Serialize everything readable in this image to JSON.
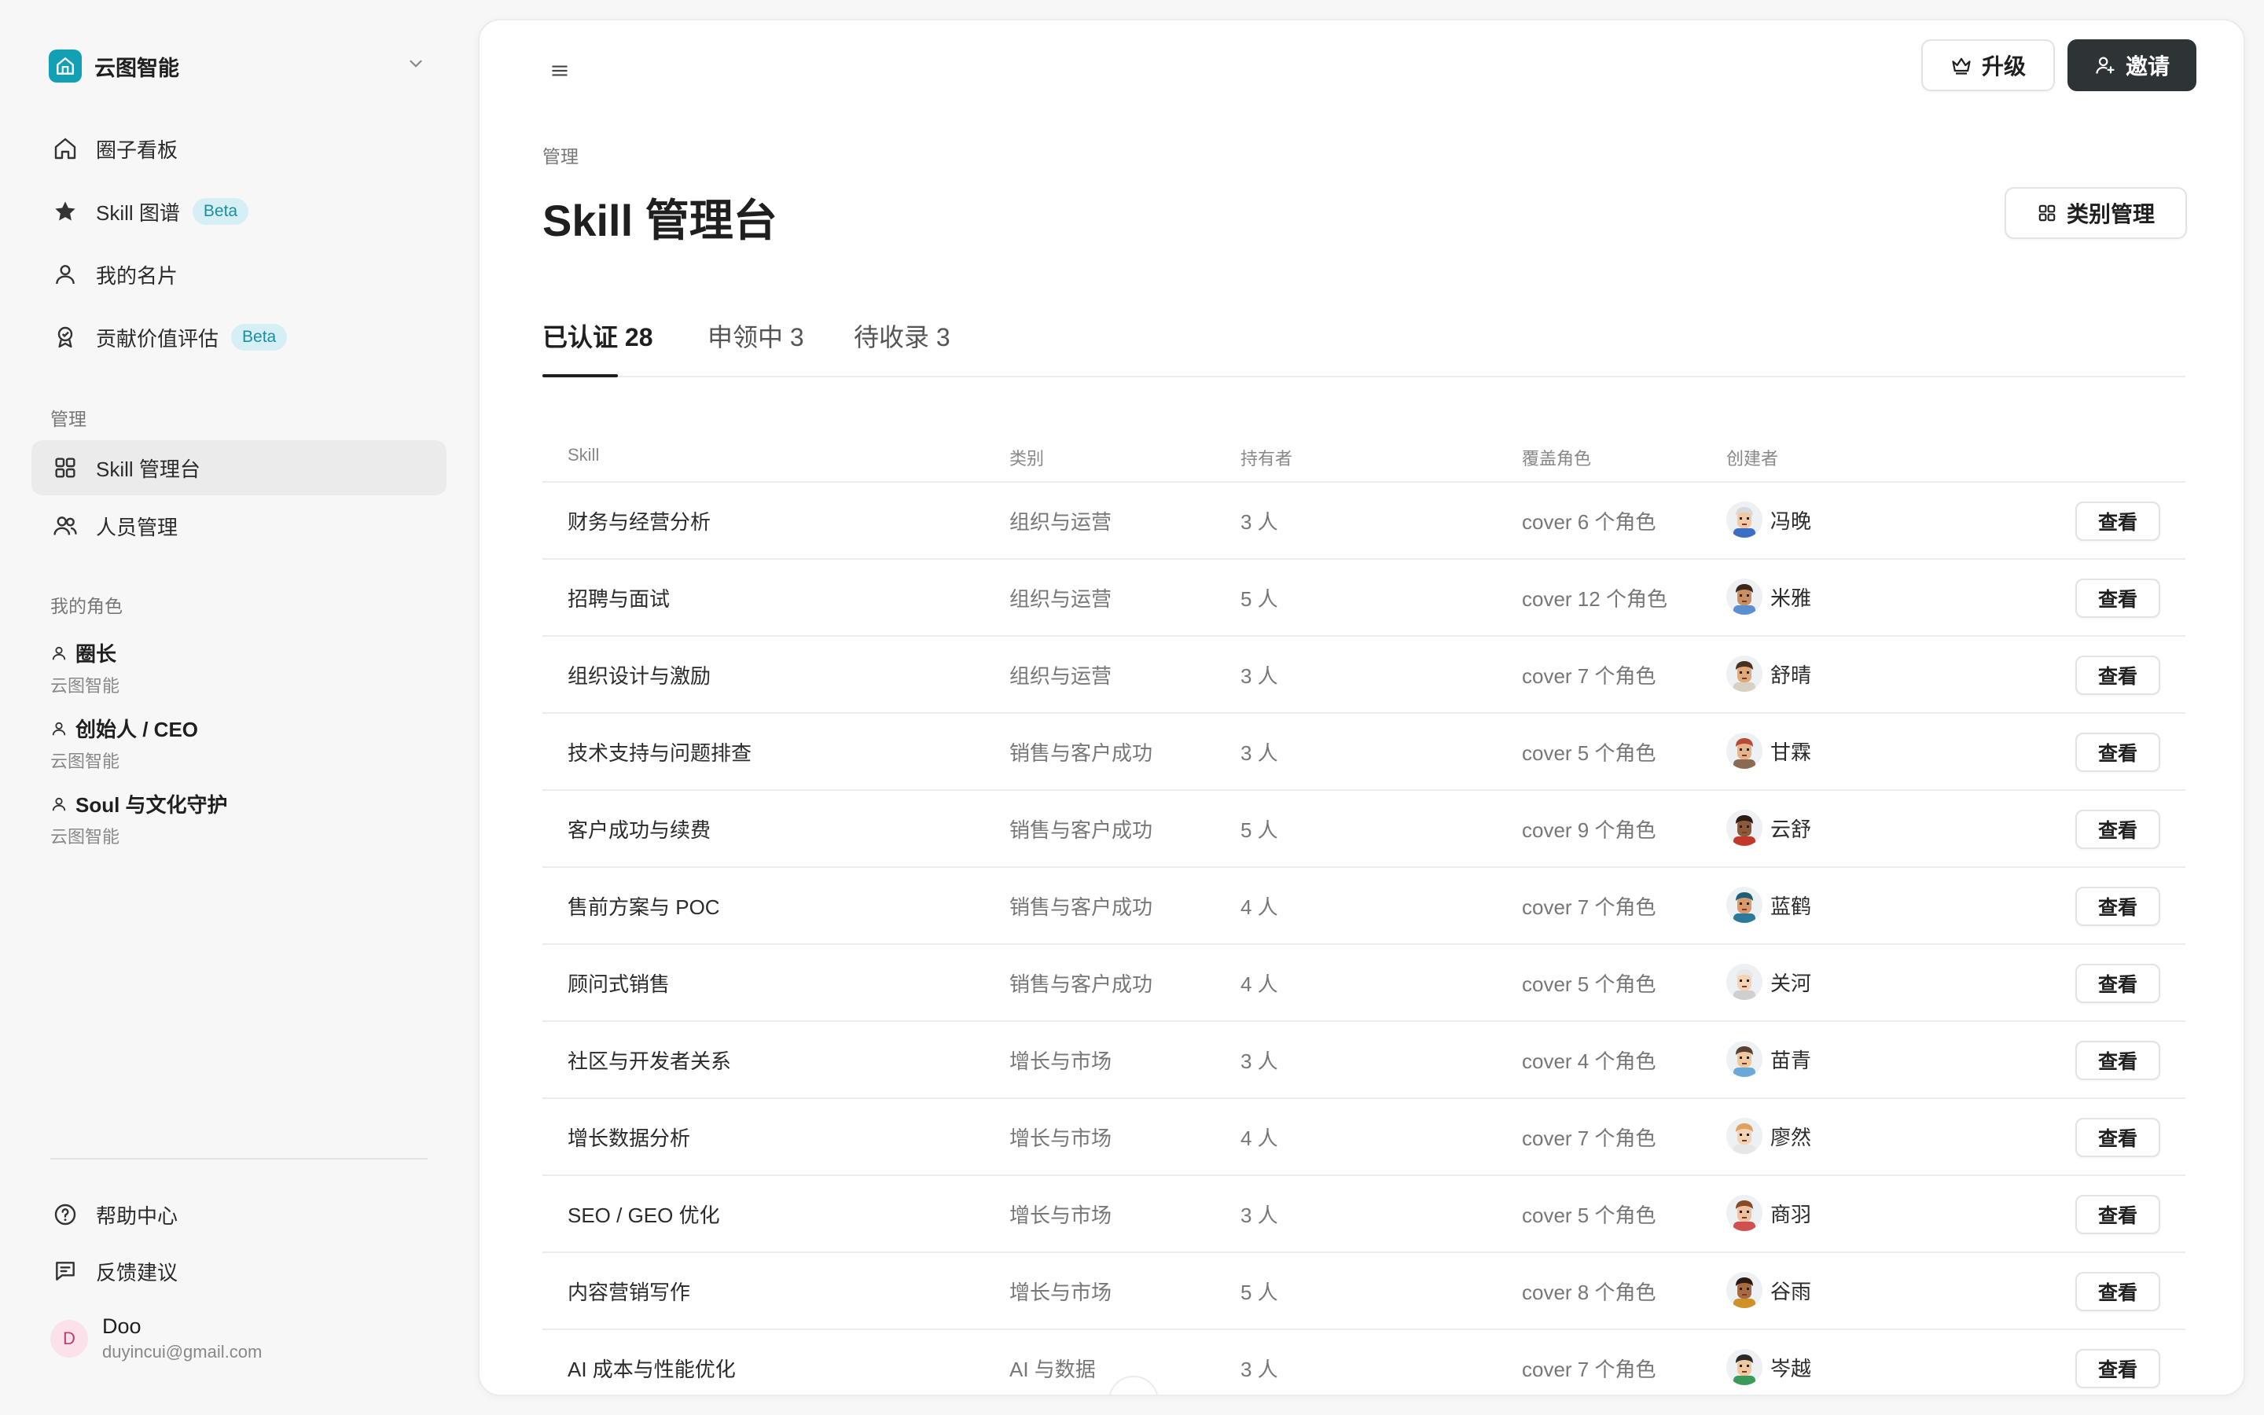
{
  "workspace": {
    "name": "云图智能"
  },
  "sidebar": {
    "nav": [
      {
        "label": "圈子看板",
        "icon": "home-icon"
      },
      {
        "label": "Skill 图谱",
        "icon": "star-icon",
        "badge": "Beta"
      },
      {
        "label": "我的名片",
        "icon": "user-icon"
      },
      {
        "label": "贡献价值评估",
        "icon": "award-icon",
        "badge": "Beta"
      }
    ],
    "manage_label": "管理",
    "manage_items": [
      {
        "label": "Skill 管理台",
        "icon": "grid-icon",
        "active": true
      },
      {
        "label": "人员管理",
        "icon": "users-icon"
      }
    ],
    "roles_label": "我的角色",
    "roles": [
      {
        "title": "圈长",
        "sub": "云图智能"
      },
      {
        "title": "创始人 / CEO",
        "sub": "云图智能"
      },
      {
        "title": "Soul 与文化守护",
        "sub": "云图智能"
      }
    ],
    "footer": [
      {
        "label": "帮助中心",
        "icon": "help-icon"
      },
      {
        "label": "反馈建议",
        "icon": "feedback-icon"
      }
    ],
    "user": {
      "initial": "D",
      "name": "Doo",
      "email": "duyincui@gmail.com"
    }
  },
  "header": {
    "upgrade_label": "升级",
    "invite_label": "邀请"
  },
  "page": {
    "breadcrumb": "管理",
    "title": "Skill 管理台",
    "category_button": "类别管理"
  },
  "tabs": [
    {
      "label": "已认证 28",
      "active": true
    },
    {
      "label": "申领中 3"
    },
    {
      "label": "待收录 3"
    }
  ],
  "table": {
    "columns": [
      "Skill",
      "类别",
      "持有者",
      "覆盖角色",
      "创建者"
    ],
    "view_label": "查看",
    "rows": [
      {
        "skill": "财务与经营分析",
        "category": "组织与运营",
        "holders": "3 人",
        "cover": "cover 6 个角色",
        "creator": "冯晚",
        "skin": "#f1c9a5",
        "hair": "#d9d9d9",
        "shirt": "#3b6fc4"
      },
      {
        "skill": "招聘与面试",
        "category": "组织与运营",
        "holders": "5 人",
        "cover": "cover 12 个角色",
        "creator": "米雅",
        "skin": "#c98e62",
        "hair": "#3a2a1e",
        "shirt": "#5a8fd0"
      },
      {
        "skill": "组织设计与激励",
        "category": "组织与运营",
        "holders": "3 人",
        "cover": "cover 7 个角色",
        "creator": "舒晴",
        "skin": "#e0a97a",
        "hair": "#4a3020",
        "shirt": "#d8d0c0"
      },
      {
        "skill": "技术支持与问题排查",
        "category": "销售与客户成功",
        "holders": "3 人",
        "cover": "cover 5 个角色",
        "creator": "甘霖",
        "skin": "#e6b48a",
        "hair": "#b94a3a",
        "shirt": "#8a6a50"
      },
      {
        "skill": "客户成功与续费",
        "category": "销售与客户成功",
        "holders": "5 人",
        "cover": "cover 9 个角色",
        "creator": "云舒",
        "skin": "#8a5a3a",
        "hair": "#2a1a10",
        "shirt": "#c0392b"
      },
      {
        "skill": "售前方案与 POC",
        "category": "销售与客户成功",
        "holders": "4 人",
        "cover": "cover 7 个角色",
        "creator": "蓝鹤",
        "skin": "#d89a6a",
        "hair": "#1f5e78",
        "shirt": "#2b7a9a"
      },
      {
        "skill": "顾问式销售",
        "category": "销售与客户成功",
        "holders": "4 人",
        "cover": "cover 5 个角色",
        "creator": "关河",
        "skin": "#f3d3b3",
        "hair": "#e8e8e8",
        "shirt": "#cfcfcf"
      },
      {
        "skill": "社区与开发者关系",
        "category": "增长与市场",
        "holders": "3 人",
        "cover": "cover 4 个角色",
        "creator": "苗青",
        "skin": "#f0c8a0",
        "hair": "#5a4030",
        "shirt": "#6aa8d8"
      },
      {
        "skill": "增长数据分析",
        "category": "增长与市场",
        "holders": "4 人",
        "cover": "cover 7 个角色",
        "creator": "廖然",
        "skin": "#f3d3b3",
        "hair": "#e0a060",
        "shirt": "#e6e6e6"
      },
      {
        "skill": "SEO / GEO 优化",
        "category": "增长与市场",
        "holders": "3 人",
        "cover": "cover 5 个角色",
        "creator": "商羽",
        "skin": "#f0c0a0",
        "hair": "#8a4a2a",
        "shirt": "#d05050"
      },
      {
        "skill": "内容营销写作",
        "category": "增长与市场",
        "holders": "5 人",
        "cover": "cover 8 个角色",
        "creator": "谷雨",
        "skin": "#a86a40",
        "hair": "#2a1a10",
        "shirt": "#d0902a"
      },
      {
        "skill": "AI 成本与性能优化",
        "category": "AI 与数据",
        "holders": "3 人",
        "cover": "cover 7 个角色",
        "creator": "岑越",
        "skin": "#f0c8a0",
        "hair": "#2a2a2a",
        "shirt": "#3a9a5a"
      }
    ]
  },
  "colors": {
    "accent": "#14a0b4",
    "dark_button": "#2e3336",
    "beta_bg": "#d6eff4",
    "beta_fg": "#1a8ea3"
  }
}
